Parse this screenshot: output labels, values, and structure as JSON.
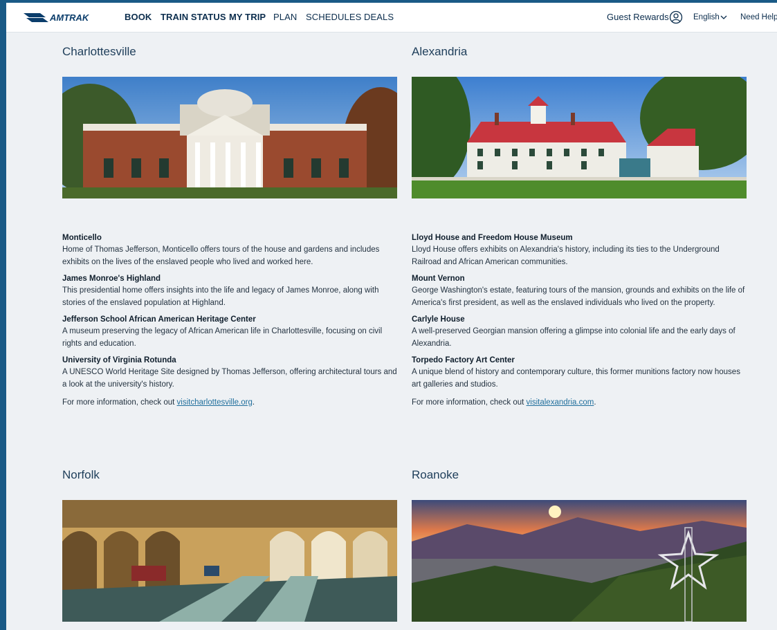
{
  "nav": {
    "brand": "AMTRAK",
    "items": [
      "BOOK",
      "TRAIN STATUS",
      "MY TRIP",
      "PLAN",
      "SCHEDULES",
      "DEALS"
    ],
    "guest_rewards": "Guest Rewards",
    "language": "English",
    "help": "Need Help?"
  },
  "cities": [
    {
      "name": "Charlottesville",
      "attractions": [
        {
          "title": "Monticello",
          "desc": "Home of Thomas Jefferson, Monticello offers tours of the house and gardens and includes exhibits on the lives of the enslaved people who lived and worked here."
        },
        {
          "title": "James Monroe's Highland",
          "desc": "This presidential home offers insights into the life and legacy of James Monroe, along with stories of the enslaved population at Highland."
        },
        {
          "title": "Jefferson School African American Heritage Center",
          "desc": "A museum preserving the legacy of African American life in Charlottesville, focusing on civil rights and education."
        },
        {
          "title": "University of Virginia Rotunda",
          "desc": "A UNESCO World Heritage Site designed by Thomas Jefferson, offering architectural tours and a look at the university's history."
        }
      ],
      "more_prefix": "For more information, check out ",
      "more_link": "visitcharlottesville.org"
    },
    {
      "name": "Alexandria",
      "attractions": [
        {
          "title": "Lloyd House and Freedom House Museum",
          "desc": "Lloyd House offers exhibits on Alexandria's history, including its ties to the Underground Railroad and African American communities."
        },
        {
          "title": "Mount Vernon",
          "desc": "George Washington's estate, featuring tours of the mansion, grounds and exhibits on the life of America's first president, as well as the enslaved individuals who lived on the property."
        },
        {
          "title": "Carlyle House",
          "desc": "A well-preserved Georgian mansion offering a glimpse into colonial life and the early days of Alexandria."
        },
        {
          "title": "Torpedo Factory Art Center",
          "desc": "A unique blend of history and contemporary culture, this former munitions factory now houses art galleries and studios."
        }
      ],
      "more_prefix": "For more information, check out ",
      "more_link": "visitalexandria.com"
    },
    {
      "name": "Norfolk"
    },
    {
      "name": "Roanoke"
    }
  ],
  "more_suffix": ".",
  "colors": {
    "brand_navy": "#0b2d4d",
    "link": "#1f6e9c",
    "page_bg": "#eef1f4",
    "outer_bg": "#1a5a86"
  }
}
